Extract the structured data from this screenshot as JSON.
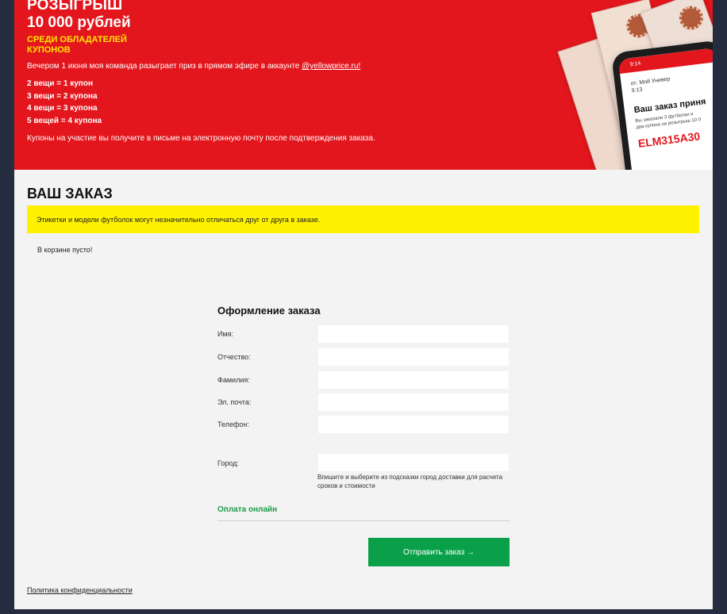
{
  "banner": {
    "title": "РОЗЫГРЫШ",
    "amount": "10 000 рублей",
    "subtitle": "СРЕДИ ОБЛАДАТЕЛЕЙ КУПОНОВ",
    "description": "Вечером 1 июня моя команда разыграет приз в прямом эфире в аккаунте",
    "account_link": "@yellowprice.ru!",
    "rules": [
      "2 вещи = 1 купон",
      "3 вещи = 2 купона",
      "4 вещи = 3 купона",
      "5 вещей = 4 купона"
    ],
    "note": "Купоны на участие вы получите в письме на электронную почту после подтверждения заказа.",
    "accent_color": "#e3161d",
    "highlight_color": "#ffe600"
  },
  "promo_phone": {
    "time": "9:14",
    "from": "от: Мой Универ",
    "sub_time": "9:13",
    "heading": "Ваш заказ приня",
    "line1": "Вы заказали 3 футболки и",
    "line2": "два купона на розыгрыш 10 0",
    "code": "ELM315A30"
  },
  "order": {
    "title": "ВАШ ЗАКАЗ",
    "notice": "Этикетки и модели футболок могут незначительно отличаться друг от друга в заказе.",
    "empty_cart": "В корзине пусто!"
  },
  "checkout": {
    "title": "Оформление заказа",
    "fields": [
      {
        "label": "Имя:",
        "value": ""
      },
      {
        "label": "Отчество:",
        "value": ""
      },
      {
        "label": "Фамилия:",
        "value": ""
      },
      {
        "label": "Эл. почта:",
        "value": ""
      },
      {
        "label": "Телефон:",
        "value": ""
      }
    ],
    "city_label": "Город:",
    "city_value": "",
    "city_hint": "Впишите и выберите из подсказки город доставки для расчета сроков и стоимости",
    "payment_label": "Оплата онлайн",
    "submit_label": "Отправить заказ →",
    "submit_color": "#0aa04a"
  },
  "footer": {
    "privacy_link": "Политика конфиденциальности"
  }
}
